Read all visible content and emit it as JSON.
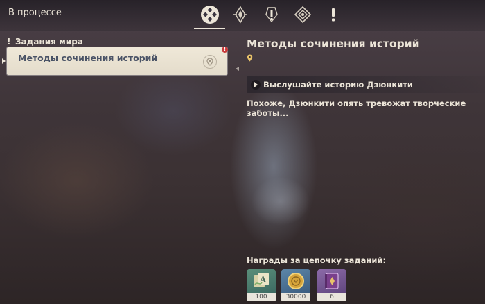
{
  "header": {
    "title": "В процессе",
    "tabs": [
      {
        "icon": "all-quests-icon",
        "active": true
      },
      {
        "icon": "archon-quest-icon",
        "active": false
      },
      {
        "icon": "story-quest-icon",
        "active": false
      },
      {
        "icon": "commission-icon",
        "active": false
      },
      {
        "icon": "world-quest-icon",
        "active": false
      }
    ]
  },
  "sidebar": {
    "category": "Задания мира",
    "quest_label": "Методы сочинения историй"
  },
  "detail": {
    "title": "Методы сочинения историй",
    "objective": "Выслушайте историю Дзюнкити",
    "description": "Похоже, Дзюнкити опять тревожат творческие заботы..."
  },
  "rewards": {
    "title": "Награды за цепочку заданий:",
    "items": [
      {
        "icon": "adventure-exp-icon",
        "count": "100"
      },
      {
        "icon": "mora-coin-icon",
        "count": "30000"
      },
      {
        "icon": "heros-wit-book-icon",
        "count": "6"
      }
    ]
  },
  "colors": {
    "text": "#ece5d8",
    "card_bg": "#efe8d8",
    "card_text": "#4a5366",
    "badge": "#c83a3a",
    "location": "#e8c26a"
  }
}
